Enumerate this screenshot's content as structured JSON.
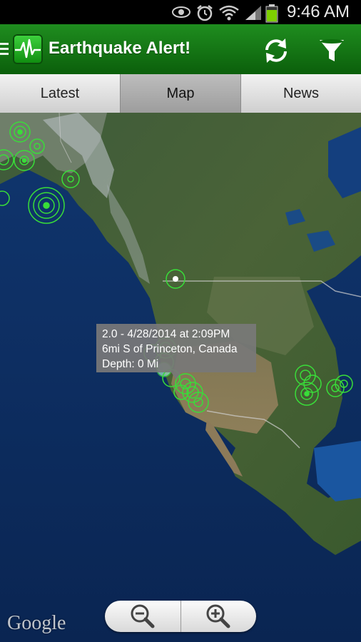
{
  "status_bar": {
    "time": "9:46 AM",
    "icons": [
      "eye-icon",
      "alarm-icon",
      "wifi-icon",
      "signal-icon",
      "battery-icon"
    ]
  },
  "action_bar": {
    "title": "Earthquake Alert!",
    "icons": [
      "menu-icon",
      "app-logo-icon",
      "refresh-icon",
      "filter-icon"
    ],
    "background_color": "#0e6e0e"
  },
  "tabs": [
    {
      "label": "Latest",
      "selected": false
    },
    {
      "label": "Map",
      "selected": true
    },
    {
      "label": "News",
      "selected": false
    }
  ],
  "map": {
    "popup": {
      "line1": "2.0 - 4/28/2014 at 2:09PM",
      "line2": "6mi S of Princeton, Canada",
      "line3": "Depth: 0 Mi"
    },
    "attribution": "Google",
    "marker_color": "#33dd33",
    "zoom_controls": [
      "zoom-out-icon",
      "zoom-in-icon"
    ]
  }
}
